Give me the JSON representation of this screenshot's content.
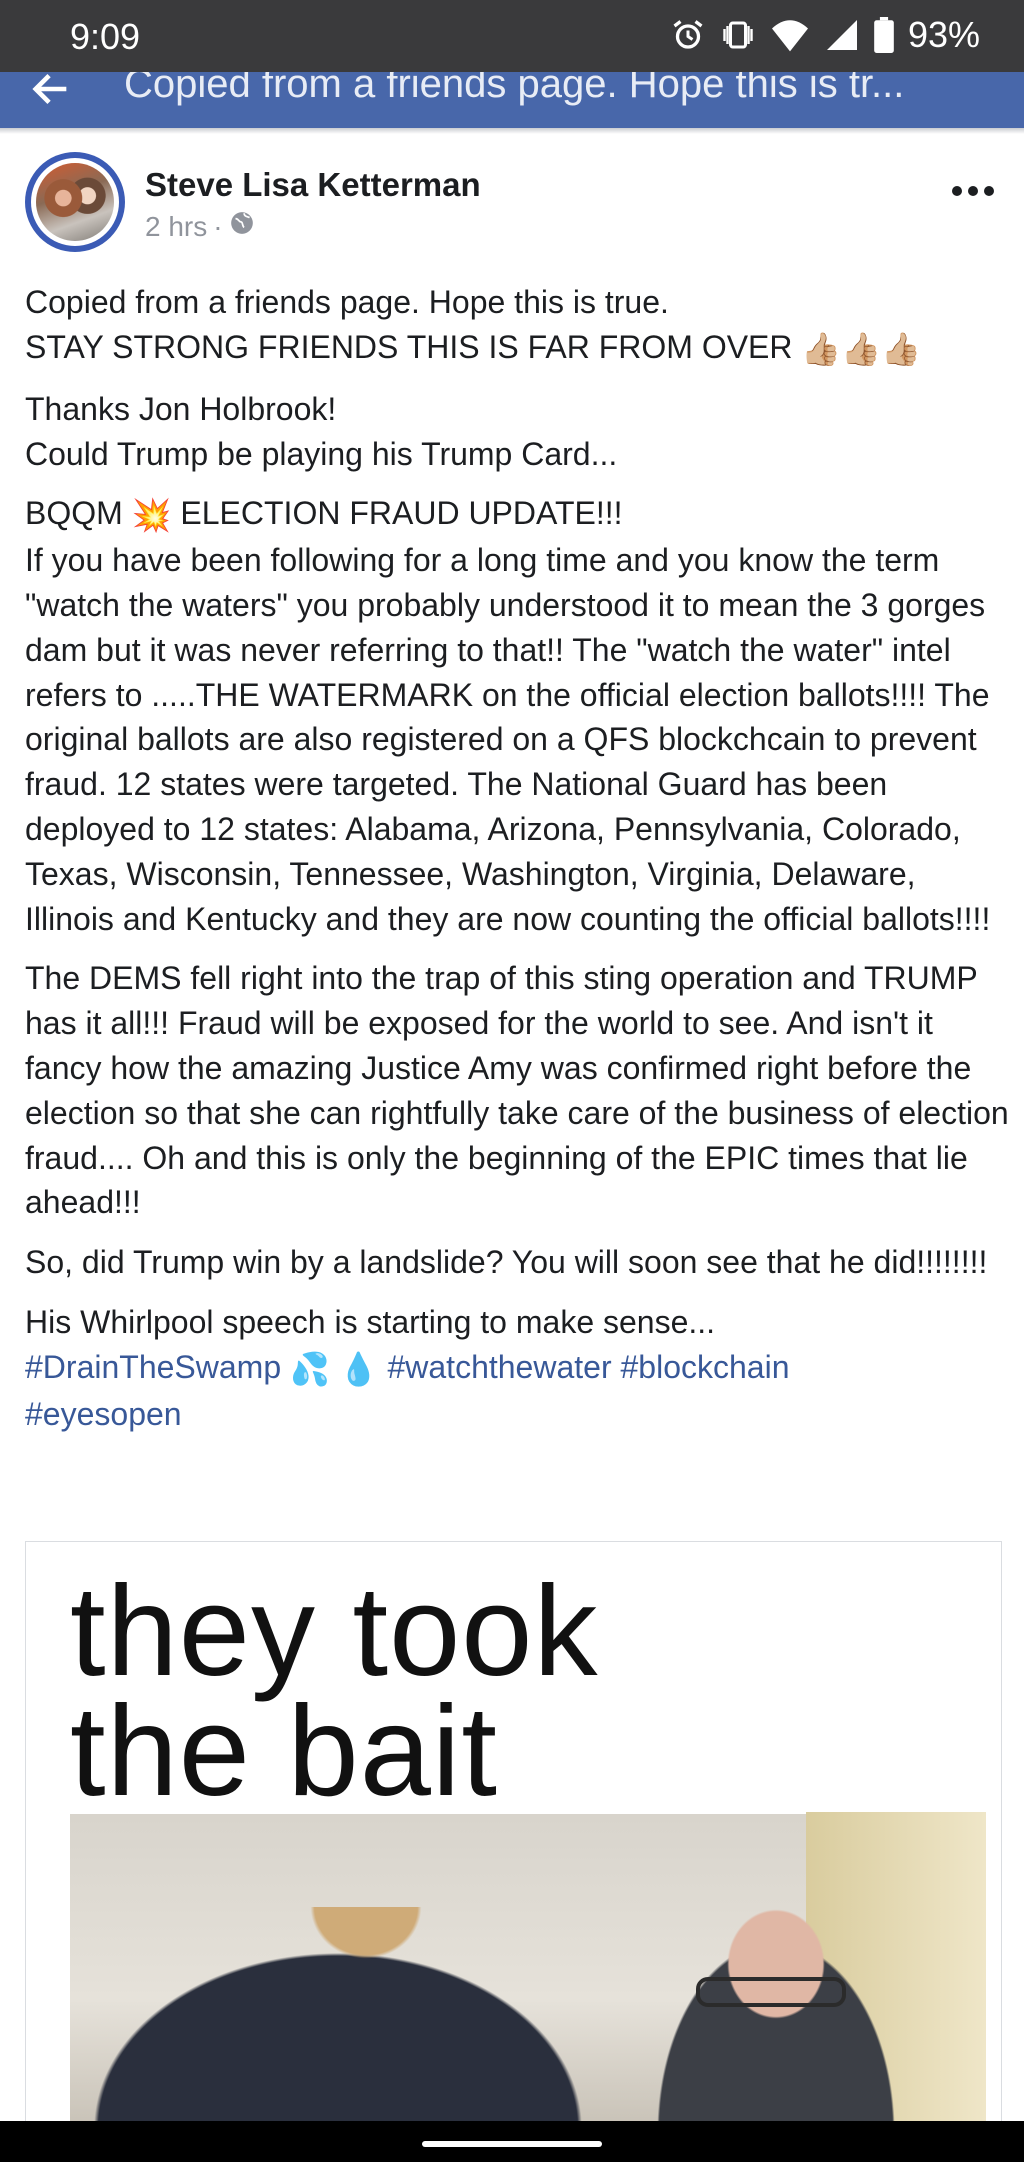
{
  "status": {
    "time": "9:09",
    "battery": "93%",
    "icons": [
      "alarm-icon",
      "vibrate-icon",
      "wifi-icon",
      "signal-icon",
      "battery-icon"
    ]
  },
  "app_bar": {
    "back_icon": "back-arrow-icon",
    "title": "Copied from a friends page. Hope this is tr..."
  },
  "post": {
    "author": "Steve Lisa Ketterman",
    "time": "2 hrs",
    "separator": "·",
    "privacy_icon": "globe-icon",
    "more_icon": "more-options-icon",
    "paragraphs": [
      {
        "line1": "Copied from a friends page. Hope this is true.",
        "line2": "STAY STRONG FRIENDS THIS IS FAR FROM OVER",
        "emoji": "👍🏼👍🏼👍🏼"
      },
      {
        "line1": "Thanks Jon Holbrook!",
        "line2": "Could Trump be playing his Trump Card..."
      },
      {
        "prefix": "BQQM",
        "emoji": "💥",
        "heading": "ELECTION FRAUD UPDATE!!!",
        "body": "If you have been following for a long time and you know the term \"watch the waters\" you probably understood it to mean the 3 gorges dam but it was never referring to that!! The \"watch the water\" intel refers to .....THE WATERMARK on the official election ballots!!!! The original ballots are also registered on a QFS blockchcain to prevent fraud. 12 states were targeted. The National Guard has been deployed to 12 states: Alabama, Arizona, Pennsylvania, Colorado, Texas, Wisconsin, Tennessee, Washington, Virginia, Delaware, Illinois and Kentucky and they are now counting the official ballots!!!!"
      },
      {
        "body": "The DEMS fell right into the trap of this sting operation and TRUMP has it all!!! Fraud will be exposed for the world to see. And isn't it fancy how the amazing Justice Amy was confirmed right before the election so that she can rightfully take care of the business of election fraud.... Oh and this is only the beginning of the EPIC times that lie ahead!!!"
      },
      {
        "body": "So, did Trump win by a landslide? You will soon see that he did!!!!!!!!"
      },
      {
        "line1": "His Whirlpool speech is starting to make sense..."
      }
    ],
    "hashtags": {
      "tag1": "#DrainTheSwamp",
      "emoji": "💦 💧",
      "tag2": "#watchthewater",
      "tag3": "#blockchain",
      "tag4": "#eyesopen"
    },
    "image": {
      "line1": "they took",
      "line2": "the bait"
    }
  },
  "colors": {
    "app_bar": "#4867aa",
    "status_bar": "#3a3a3c",
    "hashtag": "#385898",
    "text": "#1c1e21",
    "meta": "#90949c"
  }
}
